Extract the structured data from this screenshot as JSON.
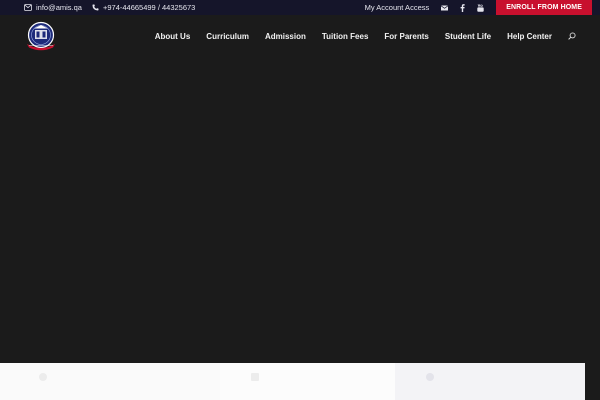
{
  "topbar": {
    "email": "info@amis.qa",
    "phone": "+974-44665499 / 44325673",
    "account": "My Account Access",
    "enroll": "ENROLL FROM HOME",
    "icons": [
      "envelope-icon",
      "phone-icon",
      "mail-icon",
      "facebook-icon",
      "youtube-icon"
    ]
  },
  "nav": {
    "items": [
      "About Us",
      "Curriculum",
      "Admission",
      "Tuition Fees",
      "For Parents",
      "Student Life",
      "Help Center"
    ]
  },
  "colors": {
    "topbar_bg": "#15152a",
    "enroll_bg": "#c8102e",
    "hero_bg": "#1b1b1b",
    "logo_blue": "#1d2a7a"
  }
}
